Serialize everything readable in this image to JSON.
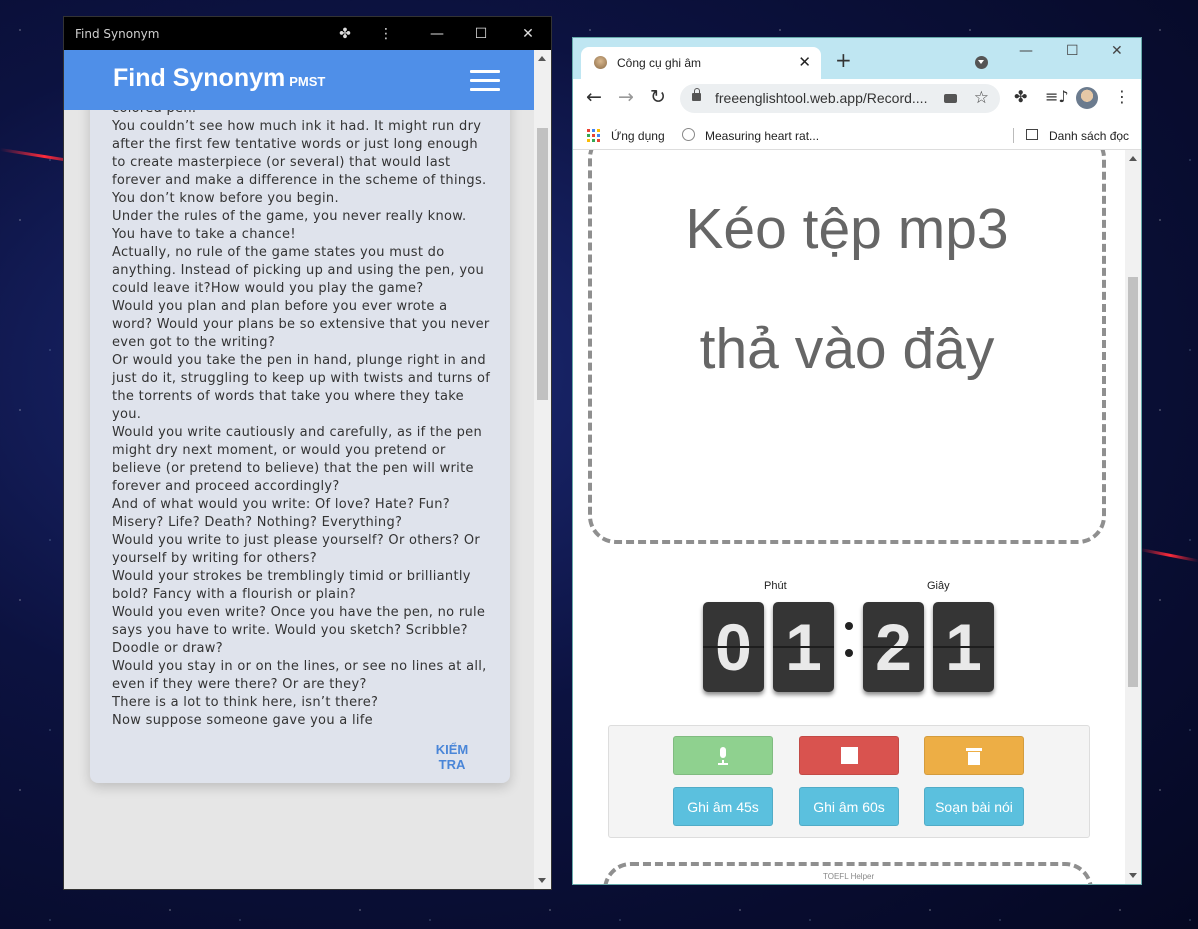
{
  "left_window": {
    "title": "Find Synonym",
    "app_title": "Find Synonym",
    "app_subtitle": "PMST",
    "passage": "colored pen.\nYou couldn’t see how much ink it had. It might run dry after the first few tentative words or just long enough to create masterpiece (or several) that would last forever and make a difference in the scheme of things. You don’t know before you begin.\nUnder the rules of the game, you never really know. You have to take a chance!\nActually, no rule of the game states you must do anything. Instead of picking up and using the pen, you could leave it?How would you play the game?\nWould you plan and plan before you ever wrote a word? Would your plans be so extensive that you never even got to the writing?\nOr would you take the pen in hand, plunge right in and just do it, struggling to keep up with twists and turns of the torrents of words that take you where they take you.\nWould you write cautiously and carefully, as if the pen might dry next moment, or would you pretend or believe (or pretend to believe) that the pen will write forever and proceed accordingly?\nAnd of what would you write: Of love? Hate? Fun? Misery? Life? Death? Nothing? Everything?\nWould you write to just please yourself? Or others? Or yourself by writing for others?\nWould your strokes be tremblingly timid or brilliantly bold? Fancy with a flourish or plain?\nWould you even write? Once you have the pen, no rule says you have to write. Would you sketch? Scribble? Doodle or draw?\nWould you stay in or on the lines, or see no lines at all, even if they were there? Or are they?\nThere is a lot to think here, isn’t there?\nNow suppose someone gave you a life",
    "check_button": "KIỂM TRA",
    "controls": {
      "minimize": "—",
      "maximize": "☐",
      "close": "✕"
    },
    "colors": {
      "header": "#4f8fe8",
      "titlebar": "#000000"
    }
  },
  "browser": {
    "tab_title": "Công cụ ghi âm",
    "tab_close": "✕",
    "new_tab": "+",
    "controls": {
      "minimize": "—",
      "maximize": "☐",
      "close": "✕"
    },
    "nav": {
      "back": "←",
      "forward": "→",
      "reload": "↻"
    },
    "url": "freeenglishtool.web.app/Record....",
    "menu": "⋮",
    "bookmarks": {
      "apps": "Ứng dụng",
      "item1": "Measuring heart rat...",
      "reading_list": "Danh sách đọc"
    }
  },
  "page": {
    "dropzone_line1": "Kéo tệp mp3",
    "dropzone_line2": "thả vào đây",
    "timer": {
      "minutes_label": "Phút",
      "seconds_label": "Giây",
      "digits": [
        "0",
        "1",
        "2",
        "1"
      ]
    },
    "buttons": {
      "record45": "Ghi âm 45s",
      "record60": "Ghi âm 60s",
      "compose": "Soạn bài nói"
    },
    "footer_text": "TOEFL Helper",
    "colors": {
      "green": "#8fd18f",
      "red": "#d9534f",
      "orange": "#edae45",
      "blue": "#5bc0de"
    }
  }
}
